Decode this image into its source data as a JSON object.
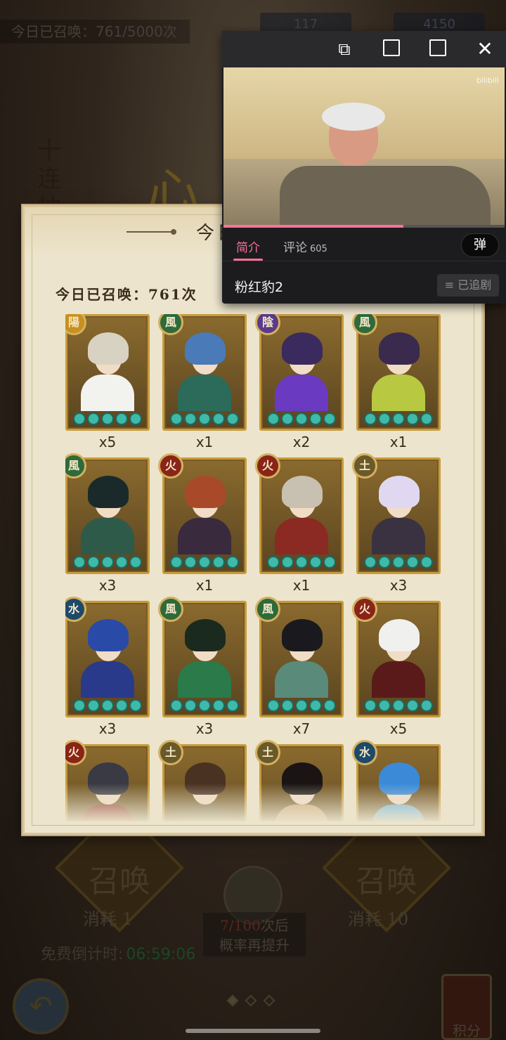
{
  "background": {
    "daily_summon_text": "今日已召唤：761/5000次",
    "currency_1": "117",
    "currency_2": "4150",
    "vertical_text": "十连抽",
    "big_text": "心",
    "single_summon_label": "召唤",
    "ten_summon_label": "召唤",
    "cost_label_single": "消耗 1",
    "cost_label_ten": "消耗 10",
    "countdown_label": "免费倒计时:",
    "countdown_time": "06:59:06",
    "rate_progress": "7/100",
    "rate_line1_suffix": "次后",
    "rate_line2": "概率再提升",
    "score_label": "积分",
    "pager_dots": 3,
    "pager_active": 0
  },
  "popup": {
    "title": "今日",
    "summon_count": "今日已召唤：761次",
    "cards": [
      {
        "element": "陽",
        "badge_color": "#c8901c",
        "hair": "#d8d2c2",
        "body": "#f2f2ee",
        "count": "x5"
      },
      {
        "element": "風",
        "badge_color": "#2e6a3a",
        "hair": "#4a7ab8",
        "body": "#2c6a5a",
        "count": "x1"
      },
      {
        "element": "陰",
        "badge_color": "#5a3a8a",
        "hair": "#3a2a5e",
        "body": "#6a3ac0",
        "count": "x2"
      },
      {
        "element": "風",
        "badge_color": "#2e6a3a",
        "hair": "#3a2a4e",
        "body": "#b8c840",
        "count": "x1"
      },
      {
        "element": "風",
        "badge_color": "#2e6a3a",
        "hair": "#1a2a2a",
        "body": "#2e5a4a",
        "count": "x3"
      },
      {
        "element": "火",
        "badge_color": "#8a2418",
        "hair": "#a84a2a",
        "body": "#3a2a3e",
        "count": "x1"
      },
      {
        "element": "火",
        "badge_color": "#8a2418",
        "hair": "#c8c0b0",
        "body": "#8a2a22",
        "count": "x1"
      },
      {
        "element": "土",
        "badge_color": "#6a5a2a",
        "hair": "#e0d8f0",
        "body": "#3a3240",
        "count": "x3"
      },
      {
        "element": "水",
        "badge_color": "#1e4a6a",
        "hair": "#2a4aa8",
        "body": "#2a3a8a",
        "count": "x3"
      },
      {
        "element": "風",
        "badge_color": "#2e6a3a",
        "hair": "#1a2a1e",
        "body": "#2a7a4a",
        "count": "x3"
      },
      {
        "element": "風",
        "badge_color": "#2e6a3a",
        "hair": "#1a1a1e",
        "body": "#5a8a7a",
        "count": "x7"
      },
      {
        "element": "火",
        "badge_color": "#8a2418",
        "hair": "#f0f0ee",
        "body": "#5a1a1a",
        "count": "x5"
      },
      {
        "element": "火",
        "badge_color": "#8a2418",
        "hair": "#3a3a44",
        "body": "#8a2a22",
        "count": ""
      },
      {
        "element": "土",
        "badge_color": "#6a5a2a",
        "hair": "#4a3222",
        "body": "#6a5a34",
        "count": ""
      },
      {
        "element": "土",
        "badge_color": "#6a5a2a",
        "hair": "#1a1414",
        "body": "#c8a070",
        "count": ""
      },
      {
        "element": "水",
        "badge_color": "#1e4a6a",
        "hair": "#3a8ad8",
        "body": "#5ab0e8",
        "count": ""
      }
    ]
  },
  "video": {
    "watermark": "bilibili",
    "progress_pct": 64,
    "tab_intro": "简介",
    "tab_comments": "评论",
    "comment_count": "605",
    "danmaku_label": "弹",
    "title": "粉红豹2",
    "follow_label": "已追剧"
  }
}
